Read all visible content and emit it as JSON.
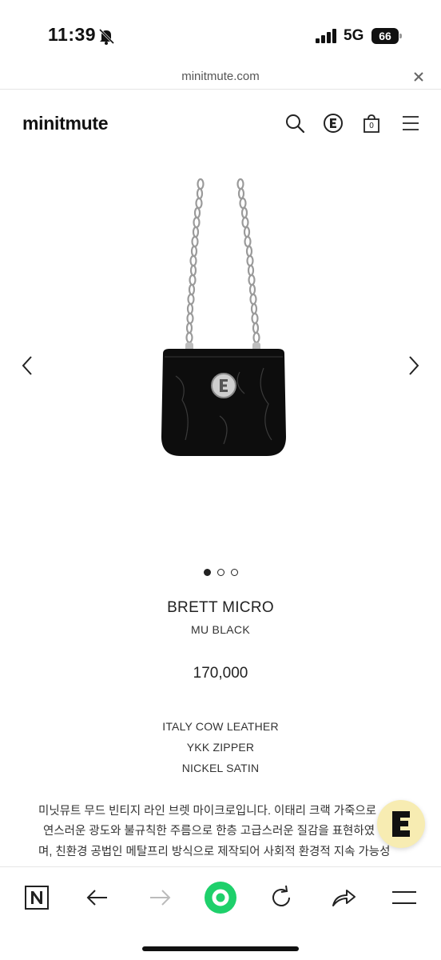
{
  "status_bar": {
    "time": "11:39",
    "network": "5G",
    "battery": "66",
    "icons": [
      "bell-slash-icon",
      "signal-icon",
      "battery-icon"
    ]
  },
  "browser": {
    "url": "minitmute.com",
    "toolbar_icons": [
      "naver-n-icon",
      "back-arrow-icon",
      "forward-arrow-icon",
      "green-home-icon",
      "reload-icon",
      "share-icon",
      "menu-icon"
    ]
  },
  "header": {
    "logo": "minitmute",
    "icons": [
      "search-icon",
      "brand-e-icon",
      "cart-icon",
      "hamburger-menu-icon"
    ],
    "cart_count": "0"
  },
  "product": {
    "name": "BRETT MICRO",
    "color": "MU BLACK",
    "price": "170,000",
    "specs": [
      "ITALY COW LEATHER",
      "YKK ZIPPER",
      "NICKEL SATIN"
    ],
    "description": [
      "미닛뮤트 무드 빈티지 라인 브렛 마이크로입니다. 이태리 크랙 가죽으로",
      "연스러운 광도와 불규칙한 주름으로 한층 고급스러운 질감을 표현하였",
      "며, 친환경 공법인 메탈프리 방식으로 제작되어 사회적 환경적 지속 가능성"
    ],
    "gallery": {
      "slides": 3,
      "active": 1
    }
  },
  "colors": {
    "accent_green": "#1ed06b",
    "fab_yellow": "#f7ecb2",
    "text": "#222222"
  }
}
